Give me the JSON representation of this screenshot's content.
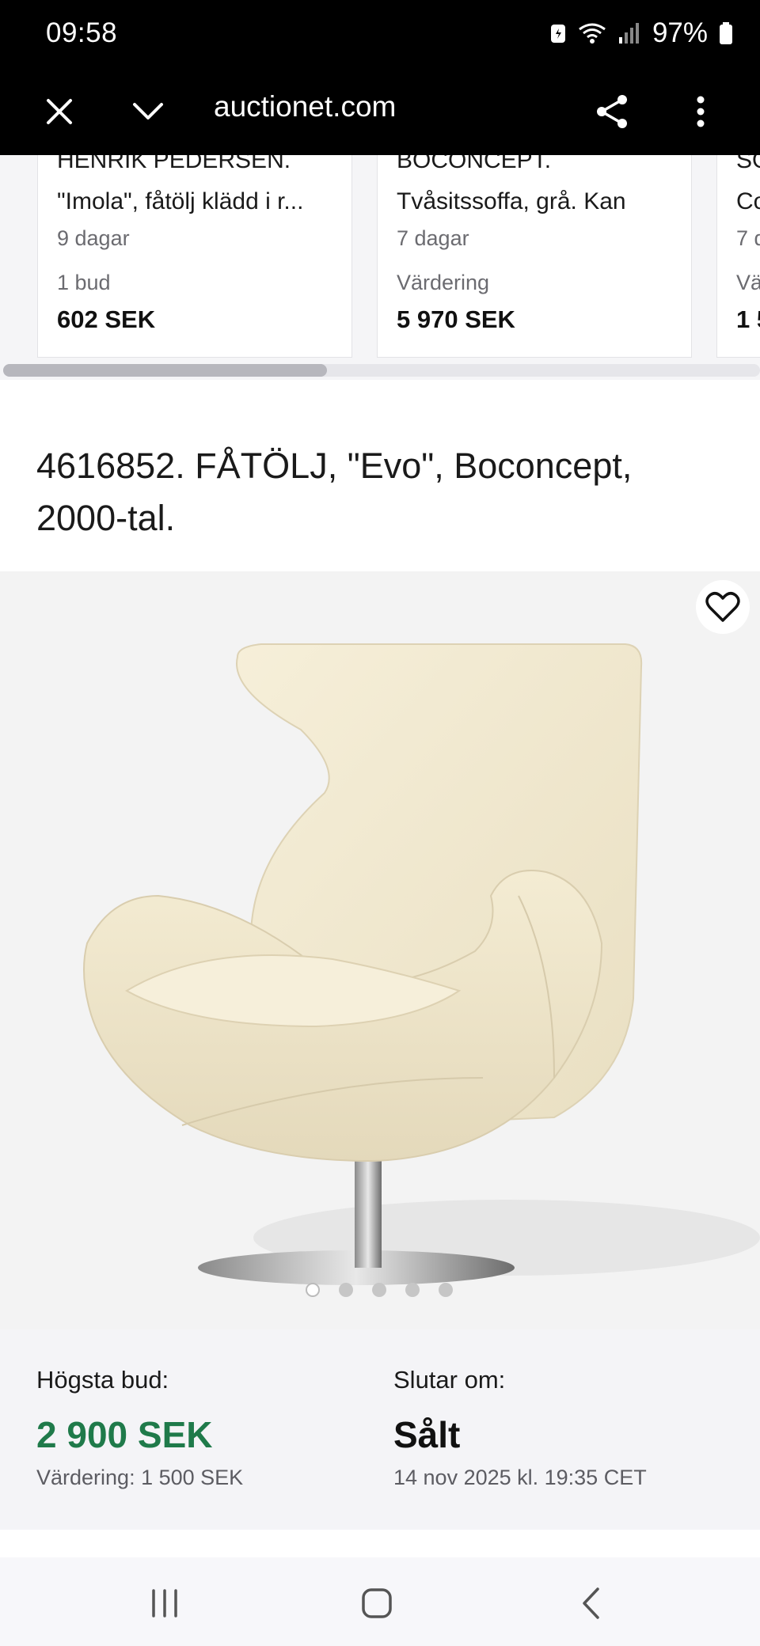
{
  "status_bar": {
    "time": "09:58",
    "battery_percent": "97%",
    "icons": [
      "battery-saver-icon",
      "wifi-icon",
      "signal-icon",
      "battery-icon"
    ]
  },
  "browser": {
    "url": "auctionet.com",
    "icons": [
      "close-icon",
      "chevron-down-icon",
      "share-icon",
      "more-vert-icon"
    ]
  },
  "recommendations": [
    {
      "line1": "HENRIK PEDERSEN.",
      "line2": "\"Imola\", fåtölj klädd i r...",
      "days": "9 dagar",
      "label": "1 bud",
      "price": "602 SEK"
    },
    {
      "line1": "BOCONCEPT.",
      "line2": "Tvåsitssoffa, grå. Kan",
      "days": "7 dagar",
      "label": "Värdering",
      "price": "5 970 SEK"
    },
    {
      "line1": "SO",
      "line2": "Co",
      "days": "7 d",
      "label": "Vä",
      "price": "1 5"
    }
  ],
  "item": {
    "title": "4616852. FÅTÖLJ, \"Evo\", Boconcept, 2000-tal.",
    "image_count": 5,
    "active_image_index": 0
  },
  "bid": {
    "highest_label": "Högsta bud:",
    "highest_amount": "2 900 SEK",
    "valuation": "Värdering: 1 500 SEK",
    "ends_label": "Slutar om:",
    "status": "Sålt",
    "end_time": "14 nov 2025 kl. 19:35 CET"
  },
  "colors": {
    "price_green": "#1f7a4a",
    "chair": "#f1e9d0"
  }
}
